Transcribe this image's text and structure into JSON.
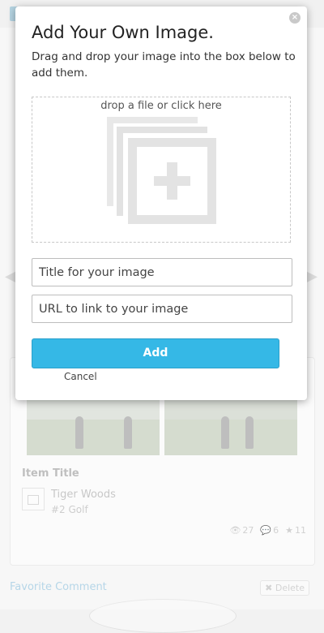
{
  "modal": {
    "title": "Add Your Own Image.",
    "description": "Drag and drop your image into the box below to add them.",
    "close_glyph": "×",
    "dropzone_label": "drop a file or click here",
    "dropzone_icon": "add-image-icon",
    "title_placeholder": "Title for your image",
    "url_placeholder": "URL to link to your image",
    "add_label": "Add",
    "cancel_label": "Cancel",
    "accent_color": "#35b8e6"
  },
  "background": {
    "card": {
      "item_title": "Item Title",
      "name": "Tiger Woods",
      "rank": "#2 Golf",
      "views": "27",
      "comments": "6",
      "favorites": "11"
    },
    "favorite_comment_label": "Favorite Comment",
    "delete_label": "Delete"
  }
}
